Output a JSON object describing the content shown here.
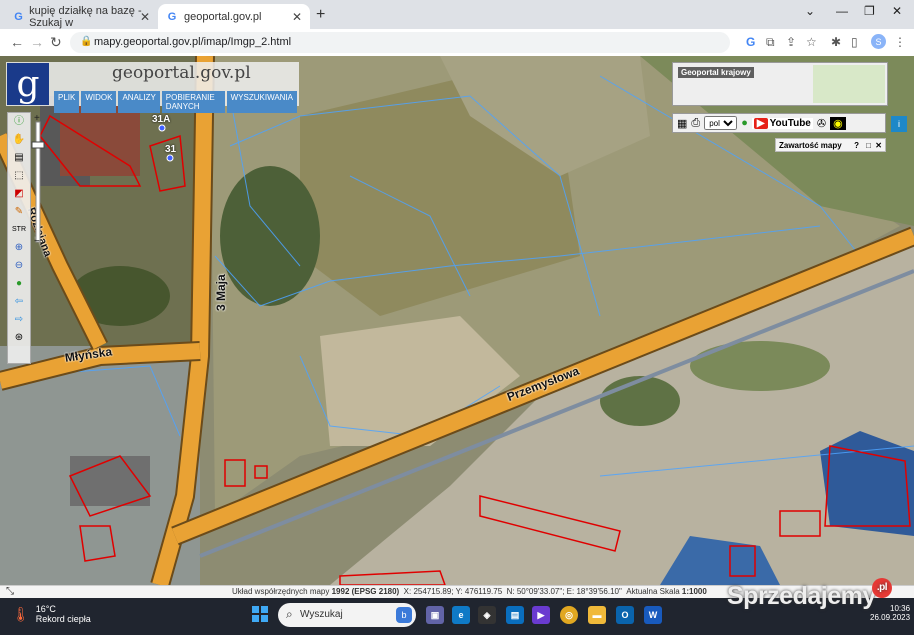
{
  "tabs": [
    {
      "label": "kupię działkę na bazę - Szukaj w",
      "icon": "google-icon",
      "active": false
    },
    {
      "label": "geoportal.gov.pl",
      "icon": "google-icon",
      "active": true
    }
  ],
  "address": {
    "url": "mapy.geoportal.gov.pl/imap/Imgp_2.html"
  },
  "profile_initial": "S",
  "geoportal": {
    "title": "geoportal.gov.pl",
    "logo": "g",
    "menu": [
      "PLIK",
      "WIDOK",
      "ANALIZY",
      "POBIERANIE DANYCH",
      "WYSZUKIWANIA"
    ]
  },
  "overview": {
    "label": "Geoportal krajowy"
  },
  "toolbar_right": {
    "lang": "pol",
    "youtube": "YouTube"
  },
  "contents_panel": {
    "title": "Zawartość mapy"
  },
  "map_labels": {
    "road1": "Przemysłowa",
    "road2": "3 Maja",
    "road3": "Młyńska",
    "road4": "Rozlejana",
    "num1": "31A",
    "num2": "31"
  },
  "status": {
    "system": "Układ współrzędnych mapy",
    "epsg": "1992 (EPSG 2180)",
    "x": "X: 254715.89",
    "y": "Y: 476119.75",
    "n": "N: 50°09'33.07\"",
    "e": "E: 18°39'56.10\"",
    "scale_label": "Aktualna Skala",
    "scale": "1:1000"
  },
  "taskbar": {
    "temp": "16°C",
    "weather": "Rekord ciepła",
    "search_placeholder": "Wyszukaj",
    "time": "10:36",
    "date": "26.09.2023"
  },
  "watermark": "Sprzedajemy"
}
